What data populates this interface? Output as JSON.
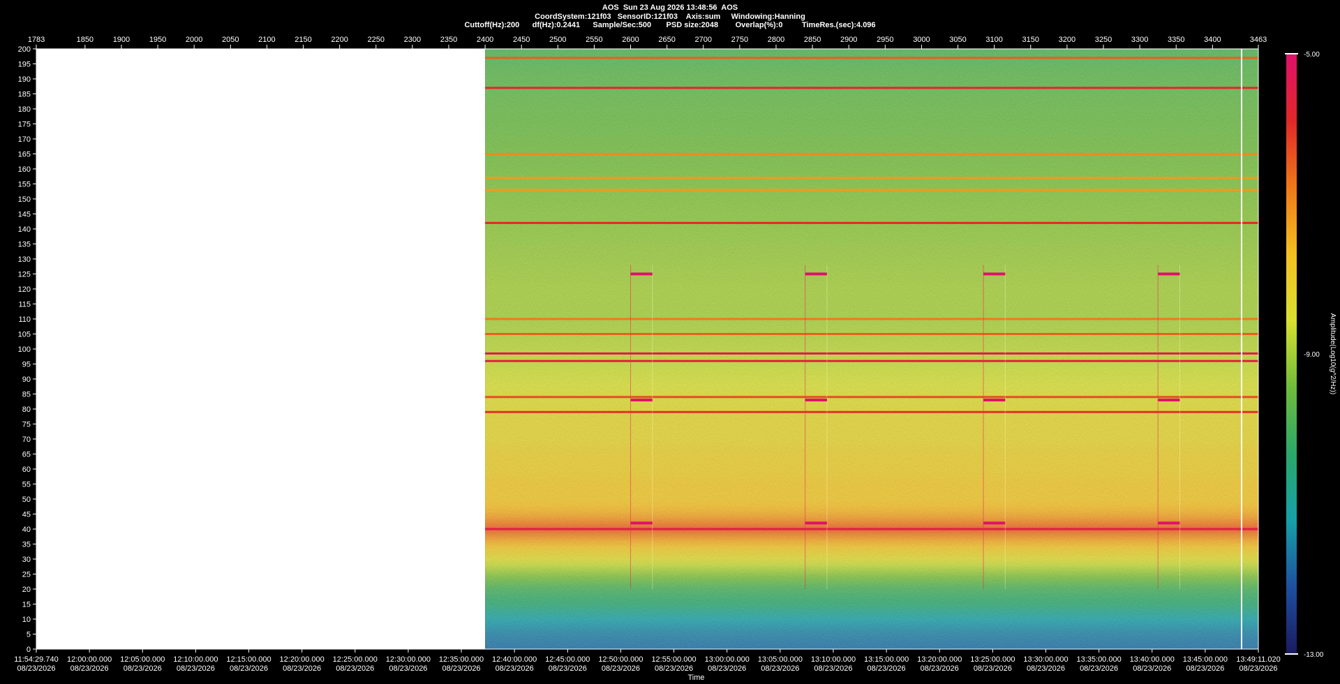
{
  "header": {
    "line1": "AOS  Sun 23 Aug 2026 13:48:56  AOS",
    "line2": "CoordSystem:121f03   SensorID:121f03    Axis:sum     Windowing:Hanning",
    "line3": "Cuttoff(Hz):200      df(Hz):0.2441      Sample/Sec:500       PSD size:2048        Overlap(%):0         TimeRes.(sec):4.096"
  },
  "chart_data": {
    "type": "heatmap",
    "top_axis_ticks": [
      "1783",
      "1850",
      "1900",
      "1950",
      "2000",
      "2050",
      "2100",
      "2150",
      "2200",
      "2250",
      "2300",
      "2350",
      "2400",
      "2450",
      "2500",
      "2550",
      "2600",
      "2650",
      "2700",
      "2750",
      "2800",
      "2850",
      "2900",
      "2950",
      "3000",
      "3050",
      "3100",
      "3150",
      "3200",
      "3250",
      "3300",
      "3350",
      "3400",
      "3463"
    ],
    "y_ticks": [
      "200",
      "195",
      "190",
      "185",
      "180",
      "175",
      "170",
      "165",
      "160",
      "155",
      "150",
      "145",
      "140",
      "135",
      "130",
      "125",
      "120",
      "115",
      "110",
      "105",
      "100",
      "95",
      "90",
      "85",
      "80",
      "75",
      "70",
      "65",
      "60",
      "55",
      "50",
      "45",
      "40",
      "35",
      "30",
      "25",
      "20",
      "15",
      "10",
      "5",
      "0"
    ],
    "ylim": [
      0,
      200
    ],
    "x_ticks": [
      {
        "time": "11:54:29.740",
        "date": "08/23/2026"
      },
      {
        "time": "12:00:00.000",
        "date": "08/23/2026"
      },
      {
        "time": "12:05:00.000",
        "date": "08/23/2026"
      },
      {
        "time": "12:10:00.000",
        "date": "08/23/2026"
      },
      {
        "time": "12:15:00.000",
        "date": "08/23/2026"
      },
      {
        "time": "12:20:00.000",
        "date": "08/23/2026"
      },
      {
        "time": "12:25:00.000",
        "date": "08/23/2026"
      },
      {
        "time": "12:30:00.000",
        "date": "08/23/2026"
      },
      {
        "time": "12:35:00.000",
        "date": "08/23/2026"
      },
      {
        "time": "12:40:00.000",
        "date": "08/23/2026"
      },
      {
        "time": "12:45:00.000",
        "date": "08/23/2026"
      },
      {
        "time": "12:50:00.000",
        "date": "08/23/2026"
      },
      {
        "time": "12:55:00.000",
        "date": "08/23/2026"
      },
      {
        "time": "13:00:00.000",
        "date": "08/23/2026"
      },
      {
        "time": "13:05:00.000",
        "date": "08/23/2026"
      },
      {
        "time": "13:10:00.000",
        "date": "08/23/2026"
      },
      {
        "time": "13:15:00.000",
        "date": "08/23/2026"
      },
      {
        "time": "13:20:00.000",
        "date": "08/23/2026"
      },
      {
        "time": "13:25:00.000",
        "date": "08/23/2026"
      },
      {
        "time": "13:30:00.000",
        "date": "08/23/2026"
      },
      {
        "time": "13:35:00.000",
        "date": "08/23/2026"
      },
      {
        "time": "13:40:00.000",
        "date": "08/23/2026"
      },
      {
        "time": "13:45:00.000",
        "date": "08/23/2026"
      },
      {
        "time": "13:49:11.020",
        "date": "08/23/2026"
      }
    ],
    "xlabel": "Time",
    "colorbar": {
      "label": "Amplitude(Log10(g^2/Hz))",
      "max_label": "-5.00",
      "mid_label": "-9.00",
      "min_label": "-13.00",
      "range": [
        -13,
        -5
      ],
      "colors": [
        "#1a1a60",
        "#1e4fa0",
        "#16a0a8",
        "#2aa86a",
        "#70bc3a",
        "#d8e030",
        "#f4c020",
        "#f07818",
        "#e02828",
        "#e0106a"
      ]
    },
    "data_start_tick": "2400",
    "tone_lines_hz": [
      197,
      187,
      165,
      157,
      153,
      142,
      110,
      105,
      98.5,
      96,
      84,
      79,
      40
    ],
    "tone_lines_amplitude": [
      -6.5,
      -5.8,
      -7.0,
      -7.2,
      -7.2,
      -5.9,
      -6.8,
      -6.5,
      -5.4,
      -5.6,
      -6.3,
      -6.0,
      -5.6
    ],
    "event_markers_hz": [
      125,
      83,
      42
    ],
    "events_start_tick": [
      "2600",
      "2840",
      "3085",
      "3325"
    ],
    "broadband_profile_hz": [
      0,
      5,
      10,
      15,
      20,
      25,
      30,
      35,
      40,
      45,
      50,
      55,
      60,
      65,
      70,
      75,
      80,
      90,
      100,
      110,
      120,
      130,
      140,
      150,
      160,
      170,
      180,
      190,
      200
    ],
    "broadband_profile_amplitude": [
      -11.8,
      -11.6,
      -11.2,
      -10.4,
      -10.0,
      -9.2,
      -8.4,
      -7.6,
      -6.4,
      -7.4,
      -7.8,
      -7.8,
      -8.0,
      -8.0,
      -8.2,
      -8.2,
      -8.3,
      -8.6,
      -8.8,
      -9.0,
      -9.0,
      -9.1,
      -9.2,
      -9.3,
      -9.4,
      -9.5,
      -9.6,
      -9.7,
      -9.9
    ]
  }
}
